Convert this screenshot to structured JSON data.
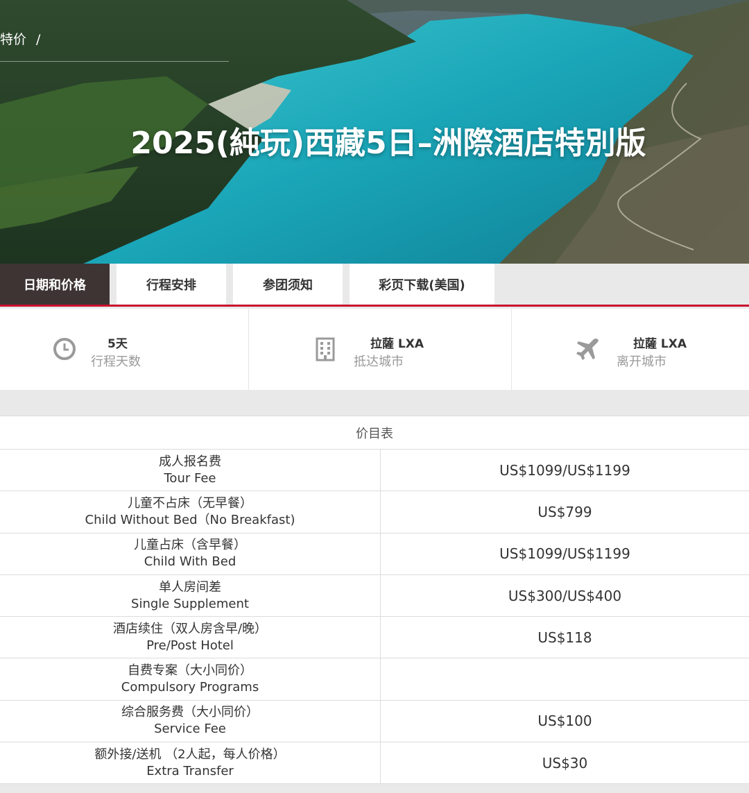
{
  "breadcrumb": {
    "text": "特价",
    "separator": "/"
  },
  "hero": {
    "title": "2025(純玩)西藏5日–洲際酒店特別版"
  },
  "tabs": [
    {
      "label": "日期和价格",
      "active": true
    },
    {
      "label": "行程安排",
      "active": false
    },
    {
      "label": "参团须知",
      "active": false
    },
    {
      "label": "彩页下载(美国)",
      "active": false
    }
  ],
  "info": [
    {
      "icon": "clock-icon",
      "value": "5天",
      "label": "行程天数"
    },
    {
      "icon": "building-icon",
      "value": "拉薩 LXA",
      "label": "抵达城市"
    },
    {
      "icon": "airplane-icon",
      "value": "拉薩 LXA",
      "label": "离开城市"
    }
  ],
  "price_table": {
    "title": "价目表",
    "rows": [
      {
        "cn": "成人报名费",
        "en": "Tour Fee",
        "price": "US$1099/US$1199"
      },
      {
        "cn": "儿童不占床（无早餐）",
        "en": "Child Without Bed（No Breakfast)",
        "price": "US$799"
      },
      {
        "cn": "儿童占床（含早餐）",
        "en": "Child With Bed",
        "price": "US$1099/US$1199"
      },
      {
        "cn": "单人房间差",
        "en": "Single Supplement",
        "price": "US$300/US$400"
      },
      {
        "cn": "酒店续住（双人房含早/晚）",
        "en": "Pre/Post Hotel",
        "price": "US$118"
      },
      {
        "cn": "自费专案（大小同价）",
        "en": "Compulsory Programs",
        "price": ""
      },
      {
        "cn": "综合服务费（大小同价）",
        "en": "Service Fee",
        "price": "US$100"
      },
      {
        "cn": "额外接/送机 （2人起，每人价格）",
        "en": "Extra Transfer",
        "price": "US$30"
      }
    ]
  },
  "colors": {
    "accent": "#c8102e",
    "active_tab": "#3d3433"
  }
}
